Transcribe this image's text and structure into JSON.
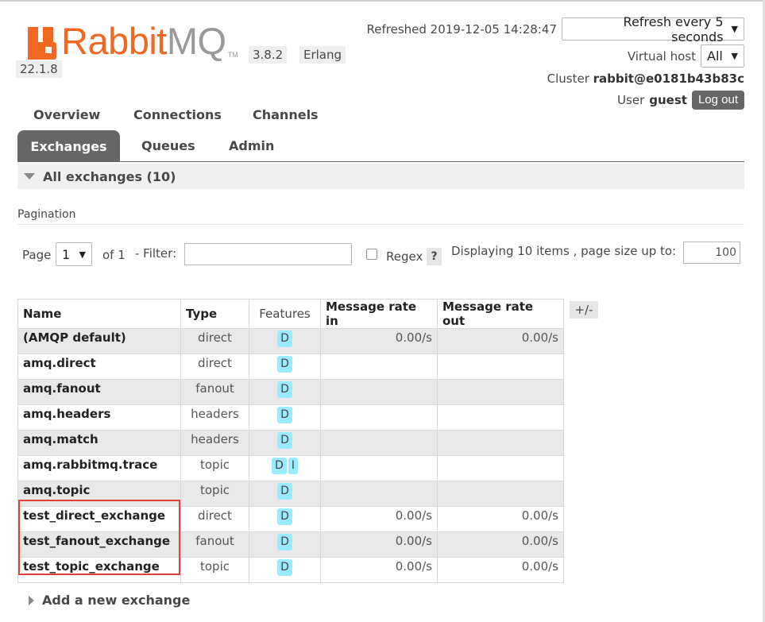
{
  "logo": {
    "brand": "Rabbit",
    "brand_suffix": "MQ",
    "tm": "TM"
  },
  "versions": {
    "rabbitmq": "3.8.2",
    "erlang_label": "Erlang",
    "erlang": "22.1.8"
  },
  "header": {
    "refreshed": "Refreshed 2019-12-05 14:28:47",
    "refresh_option": "Refresh every 5 seconds",
    "vhost_label": "Virtual host",
    "vhost_value": "All",
    "cluster_label": "Cluster",
    "cluster_value": "rabbit@e0181b43b83c",
    "user_label": "User",
    "user_value": "guest",
    "logout": "Log out"
  },
  "nav": {
    "overview": "Overview",
    "connections": "Connections",
    "channels": "Channels",
    "exchanges": "Exchanges",
    "queues": "Queues",
    "admin": "Admin"
  },
  "section": {
    "title": "All exchanges (10)"
  },
  "pagination": {
    "label": "Pagination",
    "page_label": "Page",
    "page_value": "1",
    "of": "of 1",
    "filter_label": "- Filter:",
    "filter_value": "",
    "regex_label": "Regex",
    "help": "?",
    "display_text": "Displaying 10 items , page size up to:",
    "page_size": "100"
  },
  "table": {
    "headers": [
      "Name",
      "Type",
      "Features",
      "Message rate in",
      "Message rate out"
    ],
    "plus_minus": "+/-",
    "rows": [
      {
        "name": "(AMQP default)",
        "type": "direct",
        "features": [
          "D"
        ],
        "rate_in": "0.00/s",
        "rate_out": "0.00/s"
      },
      {
        "name": "amq.direct",
        "type": "direct",
        "features": [
          "D"
        ],
        "rate_in": "",
        "rate_out": ""
      },
      {
        "name": "amq.fanout",
        "type": "fanout",
        "features": [
          "D"
        ],
        "rate_in": "",
        "rate_out": ""
      },
      {
        "name": "amq.headers",
        "type": "headers",
        "features": [
          "D"
        ],
        "rate_in": "",
        "rate_out": ""
      },
      {
        "name": "amq.match",
        "type": "headers",
        "features": [
          "D"
        ],
        "rate_in": "",
        "rate_out": ""
      },
      {
        "name": "amq.rabbitmq.trace",
        "type": "topic",
        "features": [
          "D",
          "I"
        ],
        "rate_in": "",
        "rate_out": ""
      },
      {
        "name": "amq.topic",
        "type": "topic",
        "features": [
          "D"
        ],
        "rate_in": "",
        "rate_out": ""
      },
      {
        "name": "test_direct_exchange",
        "type": "direct",
        "features": [
          "D"
        ],
        "rate_in": "0.00/s",
        "rate_out": "0.00/s"
      },
      {
        "name": "test_fanout_exchange",
        "type": "fanout",
        "features": [
          "D"
        ],
        "rate_in": "0.00/s",
        "rate_out": "0.00/s"
      },
      {
        "name": "test_topic_exchange",
        "type": "topic",
        "features": [
          "D"
        ],
        "rate_in": "0.00/s",
        "rate_out": "0.00/s"
      }
    ]
  },
  "add_new": "Add a new exchange",
  "colors": {
    "brand_orange": "#f26722",
    "tab_active": "#666666",
    "badge": "#99ebff",
    "highlight": "#e0403a"
  }
}
